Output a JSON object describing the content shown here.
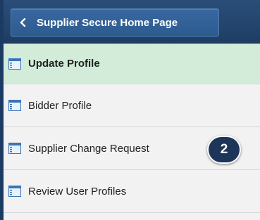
{
  "back_button": {
    "label": "Supplier Secure Home Page",
    "icon": "chevron-left-icon"
  },
  "menu": {
    "items": [
      {
        "label": "Update Profile",
        "icon": "page-icon",
        "selected": true
      },
      {
        "label": "Bidder Profile",
        "icon": "page-icon",
        "selected": false
      },
      {
        "label": "Supplier Change Request",
        "icon": "page-icon",
        "selected": false
      },
      {
        "label": "Review User Profiles",
        "icon": "page-icon",
        "selected": false
      }
    ]
  },
  "callout": {
    "number": "2"
  },
  "colors": {
    "header_bg": "#1f3d63",
    "selected_bg": "#d2ecd9",
    "badge_bg": "#1c3558"
  }
}
